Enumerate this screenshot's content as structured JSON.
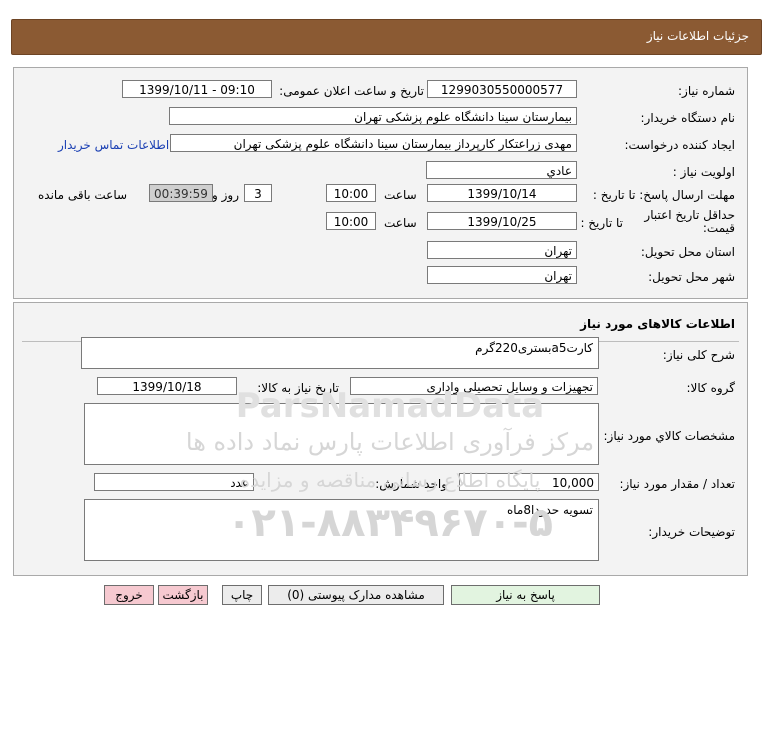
{
  "header": {
    "title": "جزئیات اطلاعات نیاز"
  },
  "info": {
    "need_number_label": "شماره نیاز:",
    "need_number": "1299030550000577",
    "announce_label": "تاریخ و ساعت اعلان عمومی:",
    "announce_value": "1399/10/11 - 09:10",
    "buyer_org_label": "نام دستگاه خریدار:",
    "buyer_org": "بیمارستان سینا دانشگاه علوم پزشکی تهران",
    "requester_label": "ایجاد کننده درخواست:",
    "requester": "مهدی  زراعتکار  کارپرداز بیمارستان سینا دانشگاه علوم پزشکی تهران",
    "contact_link": "اطلاعات تماس خریدار",
    "priority_label": "اولویت نیاز :",
    "priority": "عادي",
    "deadline_label": "مهلت ارسال پاسخ: تا تاریخ :",
    "deadline_date": "1399/10/14",
    "time_label": "ساعت",
    "deadline_time": "10:00",
    "days_value": "3",
    "days_label": "روز و",
    "remaining_timer": "00:39:59",
    "remaining_label": "ساعت باقی مانده",
    "validity_label": "حداقل تاریخ اعتبار قیمت:",
    "validity_to_label": "تا تاریخ :",
    "validity_date": "1399/10/25",
    "validity_time": "10:00",
    "province_label": "استان محل تحویل:",
    "province": "تهران",
    "city_label": "شهر محل تحویل:",
    "city": "تهران"
  },
  "goods": {
    "section_title": "اطلاعات کالاهای مورد نیاز",
    "summary_label": "شرح کلی نیاز:",
    "summary": "کارتa5بستری220گرم",
    "group_label": "گروه کالا:",
    "group": "تجهیزات و وسایل تحصیلی واداری",
    "need_date_label": "تاریخ نیاز به کالا:",
    "need_date": "1399/10/18",
    "specs_label": "مشخصات کالاي مورد نیاز:",
    "specs": "",
    "qty_label": "تعداد / مقدار مورد نیاز:",
    "qty": "10,000",
    "unit_label": "واحد شمارش:",
    "unit": "عدد",
    "notes_label": "توضیحات خریدار:",
    "notes": "تسویه حدودا8ماه"
  },
  "buttons": {
    "reply": "پاسخ به نیاز",
    "attachments": "مشاهده مدارک پیوستی (0)",
    "print": "چاپ",
    "back": "بازگشت",
    "exit": "خروج"
  },
  "watermark": {
    "brand": "ParsNamadData",
    "line1": "مرکز فرآوری اطلاعات پارس نماد داده ها",
    "line2": "پایگاه اطلاع رسانی مناقصه و مزایده",
    "phone": "۰۲۱-۸۸۳۴۹۶۷۰-۵"
  }
}
